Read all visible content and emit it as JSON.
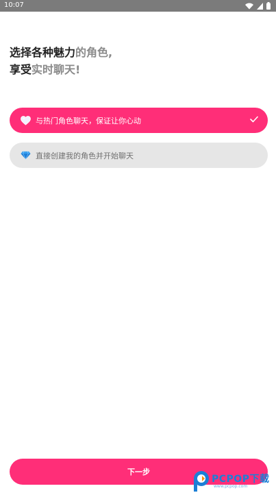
{
  "status_bar": {
    "time": "10:07",
    "icons": [
      "wifi-icon",
      "signal-icon",
      "battery-icon"
    ]
  },
  "headline": {
    "line1_bold": "选择各种魅力",
    "line1_gray": "的角色,",
    "line2_bold": "享受",
    "line2_gray": "实时聊天!"
  },
  "options": [
    {
      "label": "与热门角色聊天，保证让你心动",
      "icon": "heart-icon",
      "selected": true
    },
    {
      "label": "直接创建我的角色并开始聊天",
      "icon": "diamond-icon",
      "selected": false
    }
  ],
  "next_button": {
    "label": "下一步"
  },
  "watermark": {
    "text": "PCPOP下载",
    "subtext": "www.pcpop.com"
  },
  "colors": {
    "accent": "#ff2e78",
    "unselected_bg": "#e6e6e6",
    "status_bar_bg": "#7b7b7b"
  }
}
